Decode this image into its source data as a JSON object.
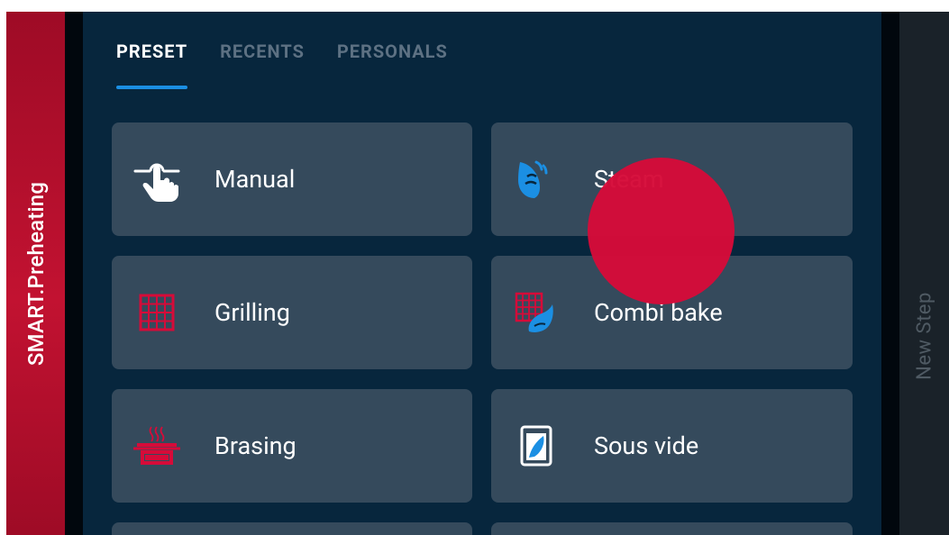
{
  "sidebar_left": {
    "label": "SMART.Preheating"
  },
  "sidebar_right": {
    "label": "New Step"
  },
  "tabs": [
    {
      "label": "PRESET",
      "active": true
    },
    {
      "label": "RECENTS",
      "active": false
    },
    {
      "label": "PERSONALS",
      "active": false
    }
  ],
  "programs": [
    {
      "label": "Manual",
      "icon": "manual-hand-icon"
    },
    {
      "label": "Steam",
      "icon": "steam-icon"
    },
    {
      "label": "Grilling",
      "icon": "grill-icon"
    },
    {
      "label": "Combi bake",
      "icon": "combi-bake-icon"
    },
    {
      "label": "Brasing",
      "icon": "braising-pot-icon"
    },
    {
      "label": "Sous vide",
      "icon": "sous-vide-icon"
    }
  ],
  "colors": {
    "accent_red": "#d60b39",
    "tab_underline": "#1b8fe3",
    "card_bg": "#354a5c",
    "steam_blue": "#1b8fe3"
  }
}
